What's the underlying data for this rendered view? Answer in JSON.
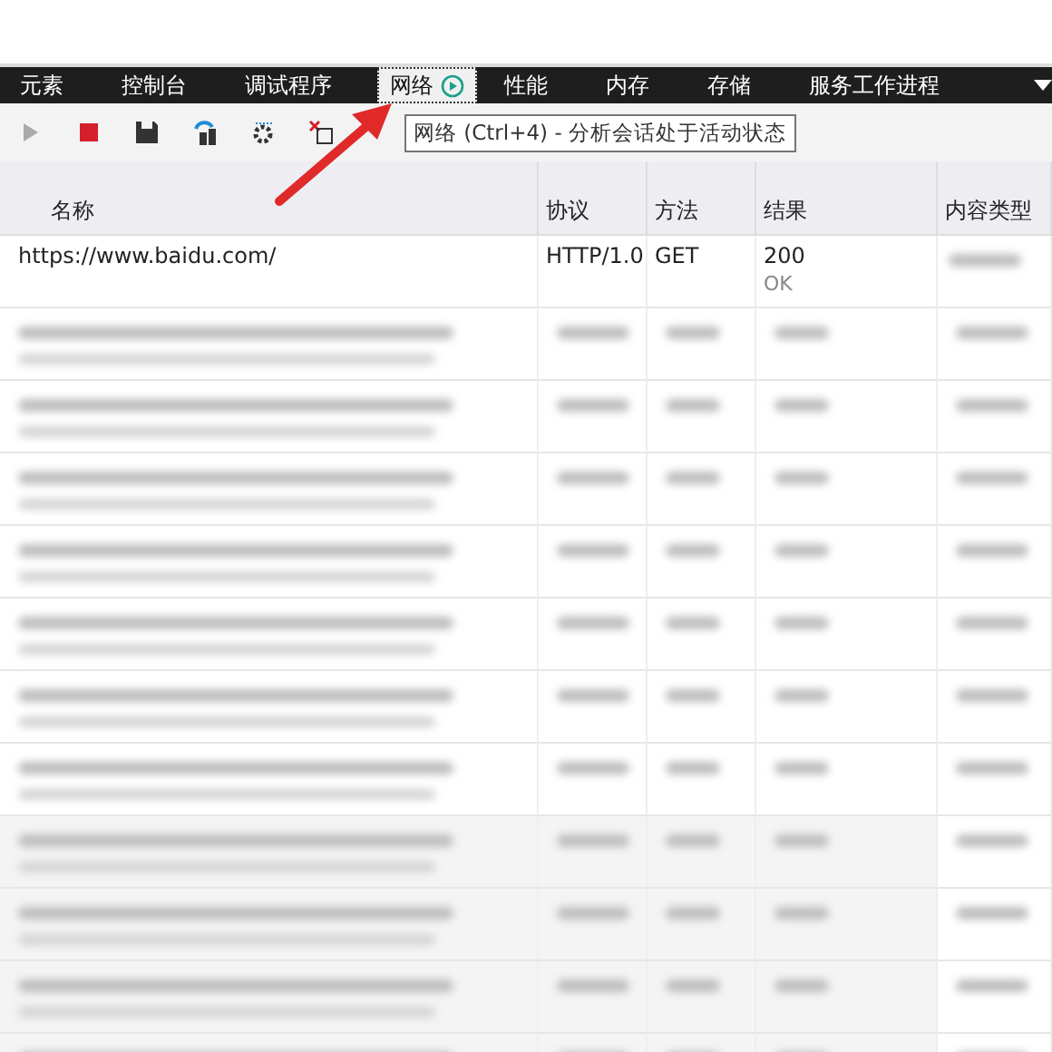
{
  "tabs": [
    {
      "label": "元素",
      "selected": false
    },
    {
      "label": "控制台",
      "selected": false
    },
    {
      "label": "调试程序",
      "selected": false
    },
    {
      "label": "网络",
      "selected": true
    },
    {
      "label": "性能",
      "selected": false
    },
    {
      "label": "内存",
      "selected": false
    },
    {
      "label": "存储",
      "selected": false
    },
    {
      "label": "服务工作进程",
      "selected": false
    }
  ],
  "toolbar": {
    "tooltip": "网络 (Ctrl+4) - 分析会话处于活动状态"
  },
  "table": {
    "columns": [
      "名称",
      "协议",
      "方法",
      "结果",
      "内容类型"
    ],
    "rows": [
      {
        "kind": "request",
        "name": "https://www.baidu.com/",
        "protocol": "HTTP/1.0",
        "method": "GET",
        "status": "200",
        "status_text": "OK"
      },
      {
        "kind": "blurred"
      },
      {
        "kind": "blurred"
      },
      {
        "kind": "blurred"
      },
      {
        "kind": "blurred"
      },
      {
        "kind": "blurred"
      },
      {
        "kind": "blurred"
      },
      {
        "kind": "blurred"
      },
      {
        "kind": "blurred"
      },
      {
        "kind": "blurred"
      },
      {
        "kind": "blurred"
      },
      {
        "kind": "blurred"
      }
    ]
  }
}
